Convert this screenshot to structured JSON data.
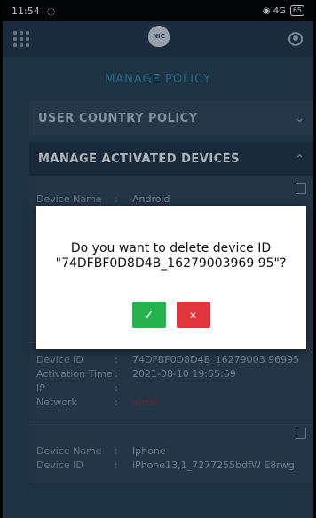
{
  "status_bar": {
    "time": "11:54",
    "battery": "65",
    "right_icons": "◉ 4G"
  },
  "app_bar": {
    "logo_text": "NIC"
  },
  "page_title": "MANAGE POLICY",
  "sections": [
    {
      "label": "USER COUNTRY POLICY",
      "chevron": "⌄"
    },
    {
      "label": "MANAGE ACTIVATED DEVICES",
      "chevron": "⌃"
    }
  ],
  "labels": {
    "device_name": "Device Name",
    "device_id": "Device ID",
    "activation_time": "Activation Time",
    "ip": "IP",
    "network": "Network",
    "sep": ":"
  },
  "devices": [
    {
      "name": "Android",
      "id": "",
      "activation_time": "",
      "ip": "",
      "network": ""
    },
    {
      "name": "",
      "id": "74DFBF0D8D4B_16279003 96995",
      "activation_time": "2021-08-10 19:55:59",
      "ip": "",
      "network": "airtel"
    },
    {
      "name": "Iphone",
      "id": "iPhone13,1_7277255bdfW E8rwg",
      "activation_time": "",
      "ip": "",
      "network": ""
    }
  ],
  "dialog": {
    "message": "Do you want to delete device ID \"74DFBF0D8D4B_16279003969 95\"?",
    "confirm_icon": "✓",
    "cancel_icon": "×"
  },
  "colors": {
    "confirm": "#26b24d",
    "cancel": "#e2353b",
    "accent": "#2c86a6"
  }
}
